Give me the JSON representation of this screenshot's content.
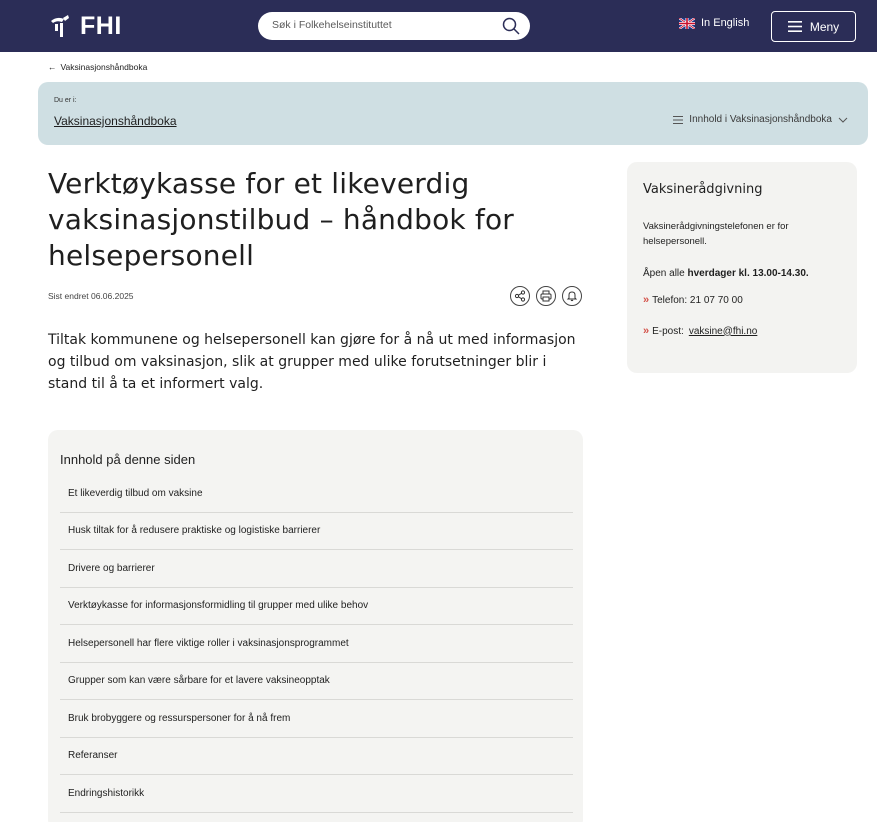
{
  "header": {
    "logo_text": "FHI",
    "search_placeholder": "Søk i Folkehelseinstituttet",
    "language_label": "In English",
    "menu_label": "Meny"
  },
  "breadcrumb": {
    "back_label": "Vaksinasjonshåndboka"
  },
  "location": {
    "you_are_in": "Du er i:",
    "section_link": "Vaksinasjonshåndboka",
    "toc_label": "Innhold i Vaksinasjonshåndboka"
  },
  "article": {
    "title": "Verktøykasse for et likeverdig vaksinasjonstilbud – håndbok for helsepersonell",
    "updated": "Sist endret 06.06.2025",
    "ingress": "Tiltak kommunene og helsepersonell kan gjøre for å nå ut med informasjon og tilbud om vaksinasjon, slik at grupper med ulike forutsetninger blir i stand til å ta et informert valg."
  },
  "toc": {
    "heading": "Innhold på denne siden",
    "items": [
      "Et likeverdig tilbud om vaksine",
      "Husk tiltak for å redusere praktiske og logistiske barrierer",
      "Drivere og barrierer",
      "Verktøykasse for informasjonsformidling til grupper med ulike behov",
      "Helsepersonell har flere viktige roller i vaksinasjonsprogrammet",
      "Grupper som kan være sårbare for et lavere vaksineopptak",
      "Bruk brobyggere og ressurspersoner for å nå frem",
      "Referanser",
      "Endringshistorikk"
    ]
  },
  "sidebar": {
    "title": "Vaksinerådgivning",
    "description": "Vaksinerådgivningstelefonen er for helsepersonell.",
    "hours_prefix": "Åpen alle",
    "hours_bold": "hverdager kl. 13.00-14.30.",
    "phone": "Telefon: 21 07 70 00",
    "email_prefix": "E-post:",
    "email": "vaksine@fhi.no"
  },
  "colors": {
    "header_bg": "#2b2d57",
    "location_bg": "#cfdfe3",
    "accent_chevron": "#d4524a"
  }
}
